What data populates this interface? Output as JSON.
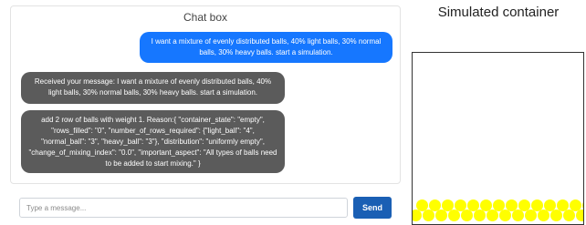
{
  "chat": {
    "title": "Chat box",
    "messages": [
      {
        "role": "user",
        "text": "I want a mixture of evenly distributed balls, 40% light balls, 30% normal balls, 30% heavy balls. start a simulation."
      },
      {
        "role": "bot",
        "text": "Received your message: I want a mixture of evenly distributed balls, 40% light balls, 30% normal balls, 30% heavy balls. start a simulation."
      },
      {
        "role": "bot",
        "text": "add 2 row of balls with weight 1. Reason:{ \"container_state\": \"empty\", \"rows_filled\": \"0\", \"number_of_rows_required\": {\"light_ball\": \"4\", \"normal_ball\": \"3\", \"heavy_ball\": \"3\"}, \"distribution\": \"uniformly empty\", \"change_of_mixing_index\": \"0.0\", \"important_aspect\": \"All types of balls need to be added to start mixing.\" }"
      }
    ]
  },
  "input": {
    "placeholder": "Type a message...",
    "value": ""
  },
  "send_button": {
    "label": "Send"
  },
  "simulation": {
    "title": "Simulated container",
    "ball_color": "#ffff00",
    "ball_rows_visible": 2,
    "balls_per_row": 13
  }
}
